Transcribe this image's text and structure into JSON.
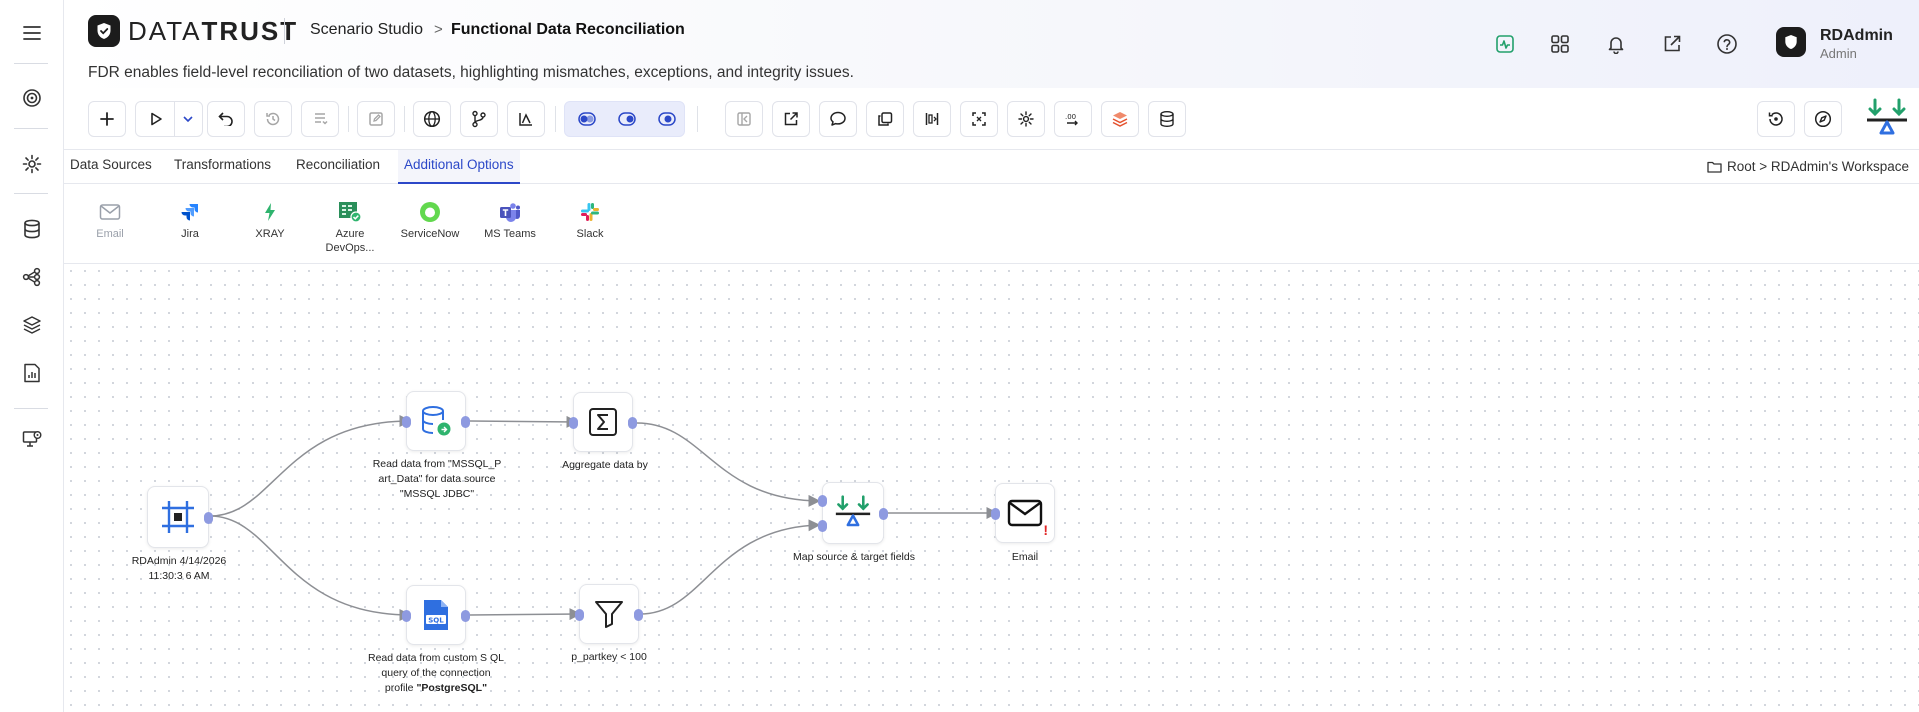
{
  "header": {
    "brand": "DATATRUST",
    "breadcrumb_parent": "Scenario Studio",
    "breadcrumb_sep": ">",
    "page_title": "Functional Data Reconciliation",
    "description": "FDR enables field-level reconciliation of two datasets, highlighting mismatches, exceptions, and integrity issues.",
    "user_name": "RDAdmin",
    "user_role": "Admin"
  },
  "tabs": [
    "Data Sources",
    "Transformations",
    "Reconciliation",
    "Additional Options"
  ],
  "active_tab": "Additional Options",
  "path": "Root > RDAdmin's Workspace",
  "integrations": [
    "Email",
    "Jira",
    "XRAY",
    "Azure DevOps...",
    "ServiceNow",
    "MS Teams",
    "Slack"
  ],
  "nodes": {
    "start_label": "RDAdmin 4/14/2026 11:30:3 6 AM",
    "read_mssql_label": "Read data from \"MSSQL_P art_Data\" for data source \"MSSQL JDBC\"",
    "aggregate_label": "Aggregate data by",
    "read_sql_prefix": "Read data from custom S QL query of the connection profile ",
    "read_sql_profile": "\"PostgreSQL\"",
    "filter_label": "p_partkey < 100",
    "map_label": "Map source & target fields",
    "email_label": "Email",
    "email_warning": "!"
  },
  "colors": {
    "accent": "#2c48c8",
    "port": "#8e9ae0",
    "edge": "#8d8f94",
    "green": "#22a06b",
    "warning": "#e02424"
  },
  "icons": {
    "rail": [
      "menu-icon",
      "target-icon",
      "settings-icon",
      "database-icon",
      "hierarchy-icon",
      "layers-icon",
      "report-icon",
      "monitor-icon"
    ],
    "header": [
      "activity-icon",
      "apps-grid-icon",
      "bell-icon",
      "external-link-icon",
      "help-icon"
    ]
  }
}
